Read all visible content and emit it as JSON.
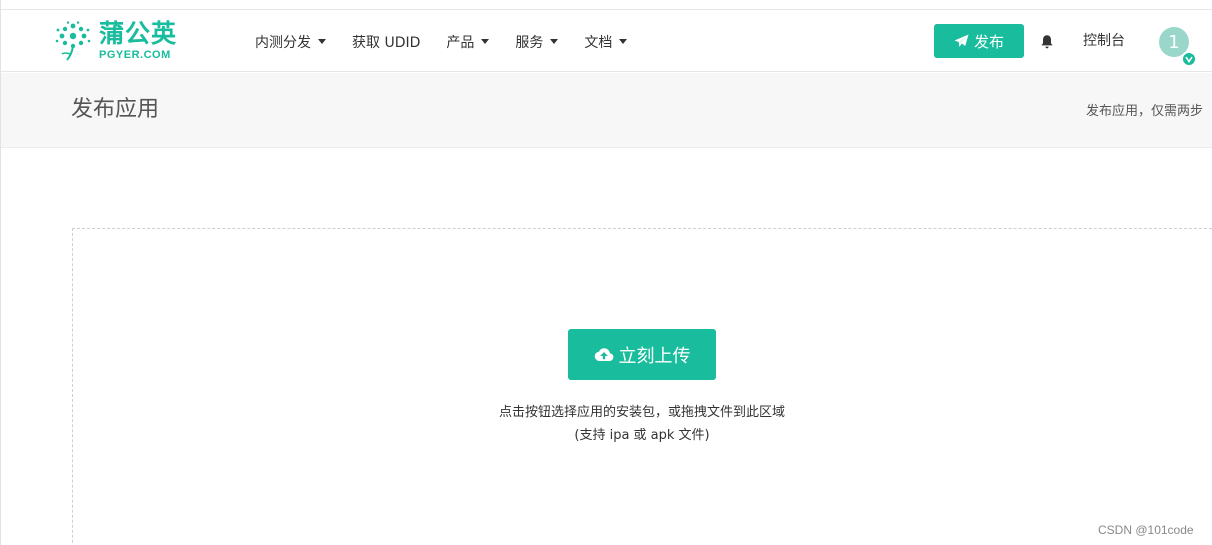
{
  "header": {
    "logo_cn": "蒲公英",
    "logo_en": "PGYER.COM",
    "nav": [
      {
        "label": "内测分发",
        "has_dropdown": true
      },
      {
        "label": "获取 UDID",
        "has_dropdown": false
      },
      {
        "label": "产品",
        "has_dropdown": true
      },
      {
        "label": "服务",
        "has_dropdown": true
      },
      {
        "label": "文档",
        "has_dropdown": true
      }
    ],
    "publish_label": "发布",
    "console_label": "控制台",
    "avatar_initial": "1"
  },
  "title_bar": {
    "title": "发布应用",
    "hint": "发布应用，仅需两步"
  },
  "upload": {
    "button_label": "立刻上传",
    "hint_line1": "点击按钮选择应用的安装包，或拖拽文件到此区域",
    "hint_line2": "(支持 ipa 或 apk 文件)"
  },
  "watermark": "CSDN @101code",
  "colors": {
    "brand": "#19bc9c",
    "avatar_bg": "#9bd6ca"
  },
  "icons": {
    "publish": "paper-plane-icon",
    "bell": "bell-icon",
    "upload": "cloud-upload-icon",
    "verified": "verified-check-icon"
  }
}
